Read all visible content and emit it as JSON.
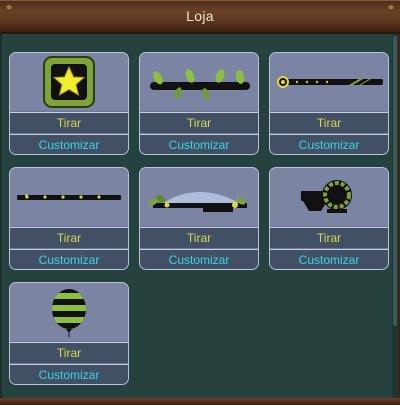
{
  "window": {
    "title": "Loja"
  },
  "items": [
    {
      "icon": "star-frame-icon",
      "use_label": "Tirar",
      "customize_label": "Customizar"
    },
    {
      "icon": "leafy-branch-icon",
      "use_label": "Tirar",
      "customize_label": "Customizar"
    },
    {
      "icon": "flower-rod-icon",
      "use_label": "Tirar",
      "customize_label": "Customizar"
    },
    {
      "icon": "heart-rod-icon",
      "use_label": "Tirar",
      "customize_label": "Customizar"
    },
    {
      "icon": "leafy-mirror-icon",
      "use_label": "Tirar",
      "customize_label": "Customizar"
    },
    {
      "icon": "wreath-cannon-icon",
      "use_label": "Tirar",
      "customize_label": "Customizar"
    },
    {
      "icon": "striped-balloon-icon",
      "use_label": "Tirar",
      "customize_label": "Customizar"
    }
  ],
  "colors": {
    "card_bg": "#7b85a3",
    "button_bg": "#425066",
    "use_text": "#d7d84a",
    "customize_text": "#37d6e0",
    "panel_bg": "#26423f",
    "title_text": "#f2e6c8"
  }
}
